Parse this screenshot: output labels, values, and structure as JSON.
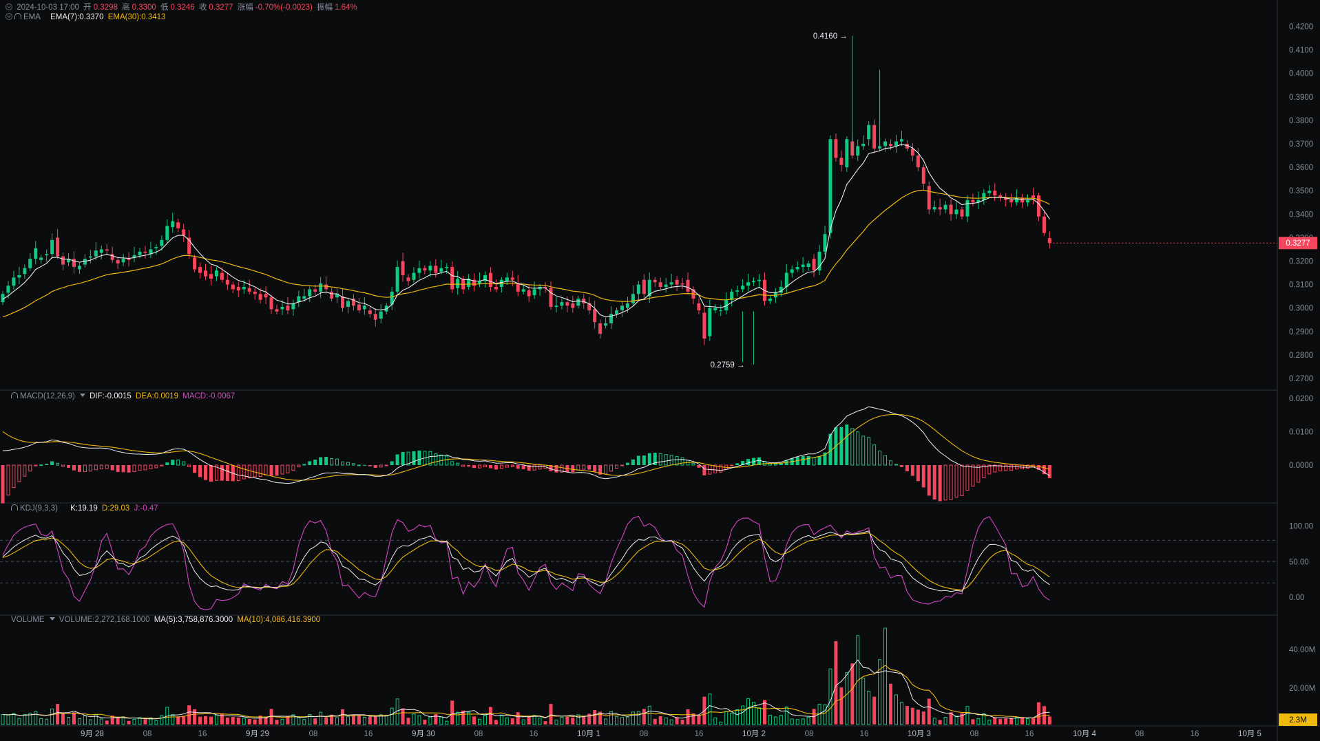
{
  "ohlc": {
    "time": "2024-10-03 17:00",
    "open_label": "开",
    "open": "0.3298",
    "high_label": "高",
    "high": "0.3300",
    "low_label": "低",
    "low": "0.3246",
    "close_label": "收",
    "close": "0.3277",
    "change_label": "涨幅",
    "change": "-0.70%(-0.0023)",
    "amp_label": "振幅",
    "amp": "1.64%"
  },
  "ema": {
    "name": "EMA",
    "ema7": "EMA(7):0.3370",
    "ema30": "EMA(30):0.3413"
  },
  "macd": {
    "name": "MACD(12,26,9)",
    "dif": "DIF:-0.0015",
    "dea": "DEA:0.0019",
    "macd": "MACD:-0.0067"
  },
  "kdj": {
    "name": "KDJ(9,3,3)",
    "k": "K:19.19",
    "d": "D:29.03",
    "j": "J:-0.47"
  },
  "vol": {
    "name": "VOLUME",
    "volume": "VOLUME:2,272,168.1000",
    "ma5": "MA(5):3,758,876.3000",
    "ma10": "MA(10):4,086,416.3900"
  },
  "colors": {
    "up": "#0ecb81",
    "down": "#f6465d",
    "ema7": "#eaecef",
    "ema30": "#f0b90b",
    "kdjJ": "#d547c3",
    "bg": "#0b0c0e",
    "grid": "#1e2329",
    "text": "#848e9c"
  },
  "chart_data": [
    {
      "type": "candlestick",
      "series": [
        {
          "name": "EMA(7)"
        },
        {
          "name": "EMA(30)"
        }
      ],
      "ylim": [
        0.27,
        0.42
      ],
      "y_ticks": [
        "0.4200",
        "0.4100",
        "0.4000",
        "0.3900",
        "0.3800",
        "0.3700",
        "0.3600",
        "0.3500",
        "0.3400",
        "0.3300",
        "0.3200",
        "0.3100",
        "0.3000",
        "0.2900",
        "0.2800",
        "0.2700"
      ],
      "x_ticks": [
        "9月 28",
        "08",
        "16",
        "9月 29",
        "08",
        "16",
        "9月 30",
        "08",
        "16",
        "10月 1",
        "08",
        "16",
        "10月 2",
        "08",
        "16",
        "10月 3",
        "08",
        "16",
        "10月 4",
        "08",
        "16",
        "10月 5"
      ],
      "annotations": {
        "max": "0.4160 →",
        "min": "0.2759 →",
        "last_price": "0.3277"
      },
      "points": [
        [
          0.3025,
          0.306
        ],
        [
          0.3065,
          0.3095
        ],
        [
          0.3095,
          0.313
        ],
        [
          0.313,
          0.314
        ],
        [
          0.3145,
          0.317
        ],
        [
          0.317,
          0.321
        ],
        [
          0.321,
          0.3255
        ],
        [
          0.3205,
          0.3215
        ],
        [
          0.3225,
          0.323
        ],
        [
          0.323,
          0.329
        ],
        [
          0.33,
          0.322
        ],
        [
          0.322,
          0.3185
        ],
        [
          0.3195,
          0.321
        ],
        [
          0.321,
          0.3175
        ],
        [
          0.3165,
          0.318
        ],
        [
          0.3185,
          0.321
        ],
        [
          0.3215,
          0.322
        ],
        [
          0.322,
          0.3245
        ],
        [
          0.3235,
          0.325
        ],
        [
          0.325,
          0.3245
        ],
        [
          0.323,
          0.3205
        ],
        [
          0.3205,
          0.319
        ],
        [
          0.3195,
          0.321
        ],
        [
          0.321,
          0.3205
        ],
        [
          0.3215,
          0.3225
        ],
        [
          0.3225,
          0.324
        ],
        [
          0.324,
          0.3235
        ],
        [
          0.323,
          0.325
        ],
        [
          0.3255,
          0.326
        ],
        [
          0.3265,
          0.329
        ],
        [
          0.329,
          0.335
        ],
        [
          0.3345,
          0.337
        ],
        [
          0.3365,
          0.334
        ],
        [
          0.3335,
          0.331
        ],
        [
          0.33,
          0.323
        ],
        [
          0.3215,
          0.3165
        ],
        [
          0.3175,
          0.315
        ],
        [
          0.316,
          0.3135
        ],
        [
          0.3145,
          0.3125
        ],
        [
          0.3135,
          0.316
        ],
        [
          0.315,
          0.312
        ],
        [
          0.312,
          0.31
        ],
        [
          0.31,
          0.308
        ],
        [
          0.309,
          0.3075
        ],
        [
          0.308,
          0.309
        ],
        [
          0.3085,
          0.307
        ],
        [
          0.307,
          0.306
        ],
        [
          0.306,
          0.3035
        ],
        [
          0.306,
          0.3045
        ],
        [
          0.3045,
          0.2995
        ],
        [
          0.2995,
          0.2985
        ],
        [
          0.2995,
          0.3005
        ],
        [
          0.301,
          0.299
        ],
        [
          0.2995,
          0.302
        ],
        [
          0.3025,
          0.305
        ],
        [
          0.304,
          0.305
        ],
        [
          0.305,
          0.308
        ],
        [
          0.308,
          0.307
        ],
        [
          0.307,
          0.3105
        ],
        [
          0.31,
          0.308
        ],
        [
          0.307,
          0.304
        ],
        [
          0.3045,
          0.306
        ],
        [
          0.305,
          0.3
        ],
        [
          0.3005,
          0.303
        ],
        [
          0.304,
          0.301
        ],
        [
          0.3015,
          0.299
        ],
        [
          0.2995,
          0.301
        ],
        [
          0.299,
          0.2975
        ],
        [
          0.2975,
          0.295
        ],
        [
          0.2955,
          0.2985
        ],
        [
          0.2985,
          0.301
        ],
        [
          0.3015,
          0.307
        ],
        [
          0.307,
          0.3175
        ],
        [
          0.32,
          0.314
        ],
        [
          0.313,
          0.3115
        ],
        [
          0.312,
          0.315
        ],
        [
          0.315,
          0.317
        ],
        [
          0.317,
          0.316
        ],
        [
          0.316,
          0.318
        ],
        [
          0.318,
          0.315
        ],
        [
          0.3155,
          0.317
        ],
        [
          0.317,
          0.3175
        ],
        [
          0.3175,
          0.308
        ],
        [
          0.3085,
          0.3125
        ],
        [
          0.3125,
          0.308
        ],
        [
          0.309,
          0.3125
        ],
        [
          0.312,
          0.3095
        ],
        [
          0.3105,
          0.3115
        ],
        [
          0.3115,
          0.314
        ],
        [
          0.315,
          0.309
        ],
        [
          0.309,
          0.308
        ],
        [
          0.309,
          0.312
        ],
        [
          0.3115,
          0.313
        ],
        [
          0.313,
          0.312
        ],
        [
          0.3105,
          0.307
        ],
        [
          0.307,
          0.308
        ],
        [
          0.3075,
          0.305
        ],
        [
          0.3055,
          0.308
        ],
        [
          0.308,
          0.309
        ],
        [
          0.309,
          0.3085
        ],
        [
          0.3085,
          0.3005
        ],
        [
          0.3005,
          0.301
        ],
        [
          0.301,
          0.3025
        ],
        [
          0.3025,
          0.301
        ],
        [
          0.302,
          0.3
        ],
        [
          0.301,
          0.304
        ],
        [
          0.304,
          0.302
        ],
        [
          0.302,
          0.299
        ],
        [
          0.2995,
          0.294
        ],
        [
          0.2935,
          0.289
        ],
        [
          0.2925,
          0.2935
        ],
        [
          0.2935,
          0.2975
        ],
        [
          0.2975,
          0.299
        ],
        [
          0.299,
          0.301
        ],
        [
          0.3,
          0.302
        ],
        [
          0.302,
          0.306
        ],
        [
          0.306,
          0.31
        ],
        [
          0.312,
          0.306
        ],
        [
          0.305,
          0.312
        ],
        [
          0.312,
          0.311
        ],
        [
          0.311,
          0.309
        ],
        [
          0.309,
          0.31
        ],
        [
          0.31,
          0.311
        ],
        [
          0.312,
          0.31
        ],
        [
          0.3105,
          0.31
        ],
        [
          0.312,
          0.307
        ],
        [
          0.308,
          0.304
        ],
        [
          0.302,
          0.299
        ],
        [
          0.298,
          0.287
        ],
        [
          0.288,
          0.3
        ],
        [
          0.299,
          0.3
        ],
        [
          0.299,
          0.299
        ],
        [
          0.299,
          0.3035
        ],
        [
          0.3035,
          0.307
        ],
        [
          0.307,
          0.3075
        ],
        [
          0.308,
          0.3095
        ],
        [
          0.3095,
          0.311
        ],
        [
          0.311,
          0.3115
        ],
        [
          0.3115,
          0.312
        ],
        [
          0.312,
          0.303
        ],
        [
          0.303,
          0.304
        ],
        [
          0.3045,
          0.3065
        ],
        [
          0.3065,
          0.309
        ],
        [
          0.309,
          0.315
        ],
        [
          0.315,
          0.3165
        ],
        [
          0.3165,
          0.3175
        ],
        [
          0.3175,
          0.3185
        ],
        [
          0.3175,
          0.319
        ],
        [
          0.321,
          0.316
        ],
        [
          0.316,
          0.324
        ],
        [
          0.324,
          0.3315
        ],
        [
          0.332,
          0.372
        ],
        [
          0.372,
          0.364
        ],
        [
          0.364,
          0.361
        ],
        [
          0.36,
          0.372
        ],
        [
          0.371,
          0.365
        ],
        [
          0.365,
          0.369
        ],
        [
          0.369,
          0.37
        ],
        [
          0.372,
          0.378
        ],
        [
          0.378,
          0.368
        ],
        [
          0.368,
          0.369
        ],
        [
          0.369,
          0.371
        ],
        [
          0.37,
          0.369
        ],
        [
          0.369,
          0.371
        ],
        [
          0.371,
          0.372
        ],
        [
          0.37,
          0.368
        ],
        [
          0.368,
          0.365
        ],
        [
          0.365,
          0.36
        ],
        [
          0.36,
          0.353
        ],
        [
          0.352,
          0.342
        ],
        [
          0.342,
          0.343
        ],
        [
          0.343,
          0.342
        ],
        [
          0.342,
          0.344
        ],
        [
          0.344,
          0.34
        ],
        [
          0.34,
          0.342
        ],
        [
          0.342,
          0.339
        ],
        [
          0.339,
          0.346
        ],
        [
          0.346,
          0.345
        ],
        [
          0.345,
          0.346
        ],
        [
          0.346,
          0.349
        ],
        [
          0.349,
          0.35
        ],
        [
          0.35,
          0.348
        ],
        [
          0.348,
          0.347
        ],
        [
          0.347,
          0.346
        ],
        [
          0.346,
          0.345
        ],
        [
          0.345,
          0.347
        ],
        [
          0.347,
          0.345
        ],
        [
          0.345,
          0.346
        ],
        [
          0.348,
          0.347
        ],
        [
          0.348,
          0.339
        ],
        [
          0.339,
          0.332
        ],
        [
          0.3298,
          0.3277
        ]
      ]
    },
    {
      "type": "bar",
      "title": "MACD(12,26,9)",
      "ylim": [
        -0.004,
        0.021
      ],
      "y_ticks": [
        "0.0200",
        "0.0100",
        "0.0000"
      ],
      "series": [
        {
          "name": "DIF"
        },
        {
          "name": "DEA"
        },
        {
          "name": "MACD"
        }
      ]
    },
    {
      "type": "line",
      "title": "KDJ(9,3,3)",
      "ylim": [
        -10,
        110
      ],
      "y_ticks": [
        "100.00",
        "50.00",
        "0.00"
      ],
      "series": [
        {
          "name": "K"
        },
        {
          "name": "D"
        },
        {
          "name": "J"
        }
      ]
    },
    {
      "type": "bar",
      "title": "VOLUME",
      "y_ticks": [
        "40.00M",
        "20.00M"
      ],
      "last_volume": "2.3M"
    }
  ]
}
